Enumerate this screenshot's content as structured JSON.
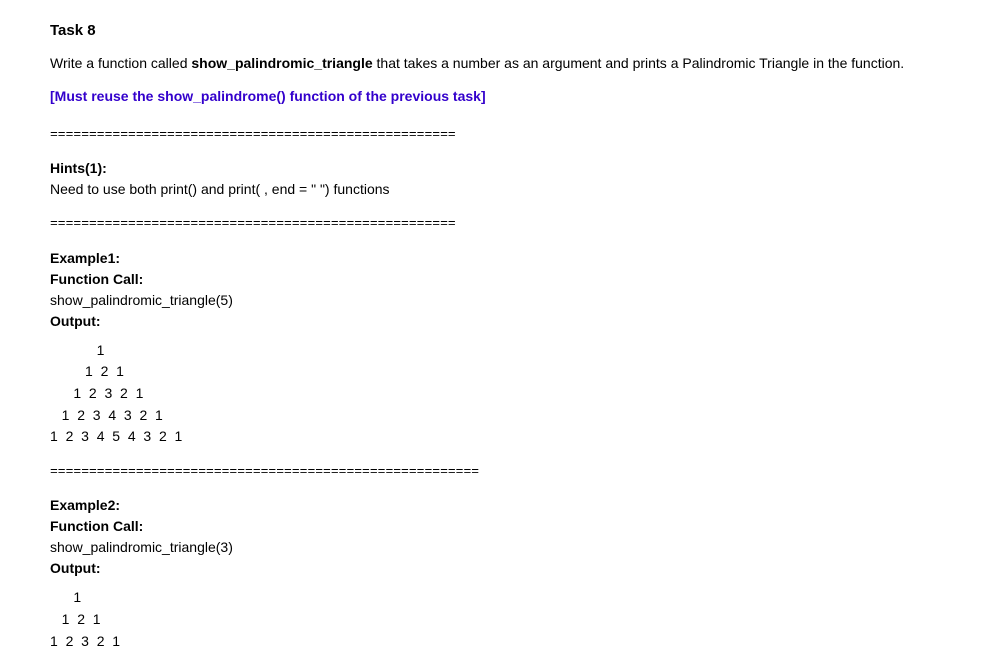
{
  "task": {
    "title": "Task 8",
    "description_pre": "Write a function called ",
    "function_name": "show_palindromic_triangle",
    "description_post": " that takes a number as an argument and prints a Palindromic Triangle in the function.",
    "reuse_note": "[Must reuse the show_palindrome() function of the previous task]"
  },
  "separators": {
    "sep1": "====================================================",
    "sep2": "====================================================",
    "sep3": "======================================================="
  },
  "hints": {
    "label": "Hints(1):",
    "text": "Need to use both print() and print( , end = \" \") functions"
  },
  "example1": {
    "label": "Example1:",
    "call_label": "Function Call:",
    "call_text": "show_palindromic_triangle(5)",
    "output_label": "Output:",
    "output_triangle": "            1\n         1  2  1\n      1  2  3  2  1\n   1  2  3  4  3  2  1\n1  2  3  4  5  4  3  2  1"
  },
  "example2": {
    "label": "Example2:",
    "call_label": "Function Call:",
    "call_text": "show_palindromic_triangle(3)",
    "output_label": "Output:",
    "output_triangle": "      1\n   1  2  1\n1  2  3  2  1"
  }
}
